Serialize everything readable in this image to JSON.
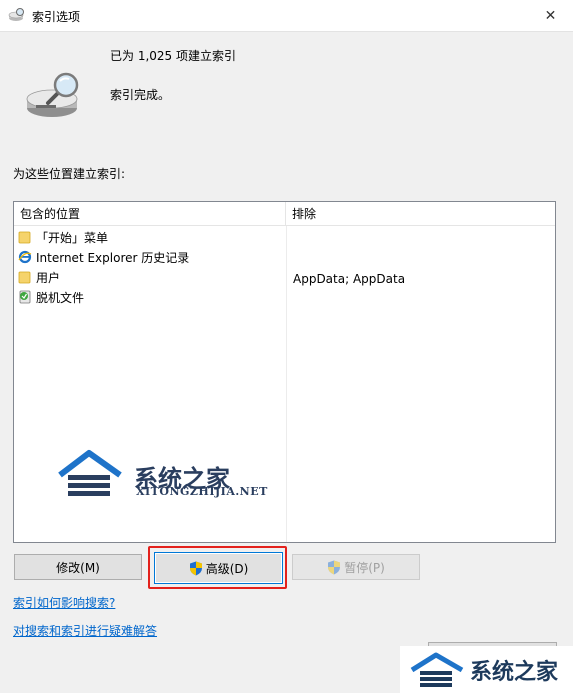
{
  "window": {
    "title": "索引选项",
    "close_glyph": "✕"
  },
  "status": {
    "indexed_count": "已为 1,025 项建立索引",
    "state": "索引完成。"
  },
  "locations": {
    "section_label": "为这些位置建立索引:",
    "columns": [
      "包含的位置",
      "排除"
    ],
    "rows": [
      {
        "name": "「开始」菜单",
        "icon": "folder-icon",
        "exclude": ""
      },
      {
        "name": "Internet Explorer 历史记录",
        "icon": "ie-icon",
        "exclude": ""
      },
      {
        "name": "用户",
        "icon": "folder-icon",
        "exclude": "AppData; AppData"
      },
      {
        "name": "脱机文件",
        "icon": "offline-files-icon",
        "exclude": ""
      }
    ]
  },
  "buttons": {
    "modify": "修改(M)",
    "advanced": "高级(D)",
    "pause": "暂停(P)",
    "close": ""
  },
  "links": {
    "how_affects": "索引如何影响搜索?",
    "troubleshoot": "对搜索和索引进行疑难解答"
  },
  "watermark": {
    "brand": "系统之家",
    "url": "XITONGZHIJIA.NET"
  },
  "colors": {
    "highlight_border": "#e3211c",
    "link": "#0066cc",
    "accent": "#0078d7"
  }
}
